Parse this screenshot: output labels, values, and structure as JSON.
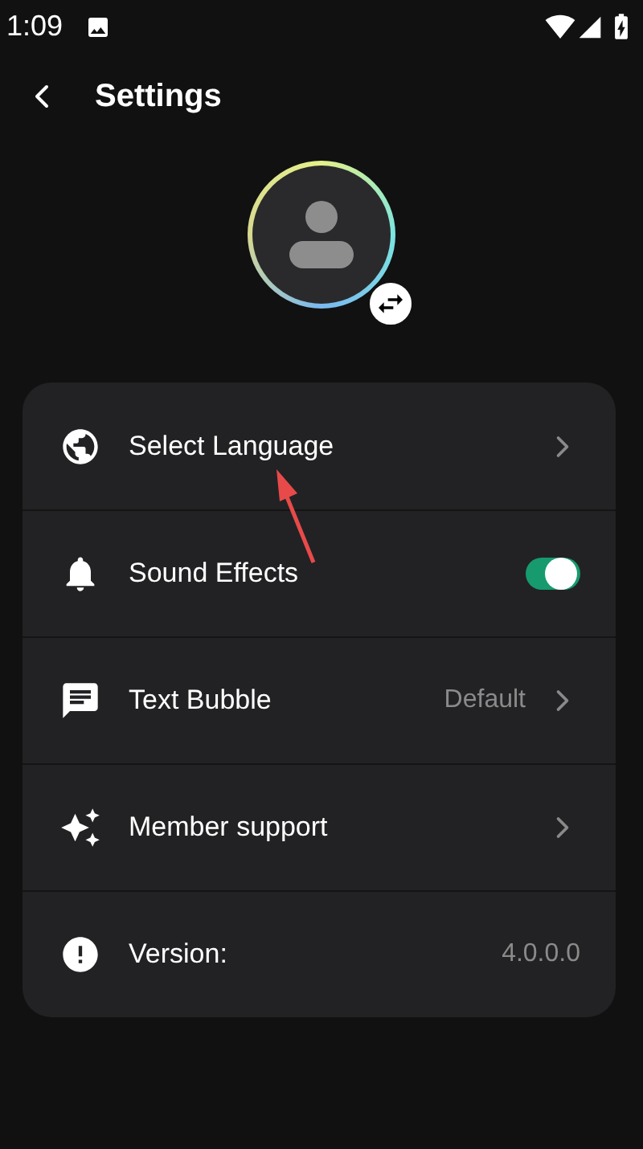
{
  "status_bar": {
    "time": "1:09"
  },
  "header": {
    "title": "Settings"
  },
  "settings": [
    {
      "kind": "link",
      "label": "Select Language"
    },
    {
      "kind": "toggle",
      "label": "Sound Effects",
      "on": true
    },
    {
      "kind": "link",
      "label": "Text Bubble",
      "value": "Default"
    },
    {
      "kind": "link",
      "label": "Member support"
    },
    {
      "kind": "info",
      "label": "Version:",
      "value": "4.0.0.0"
    }
  ]
}
